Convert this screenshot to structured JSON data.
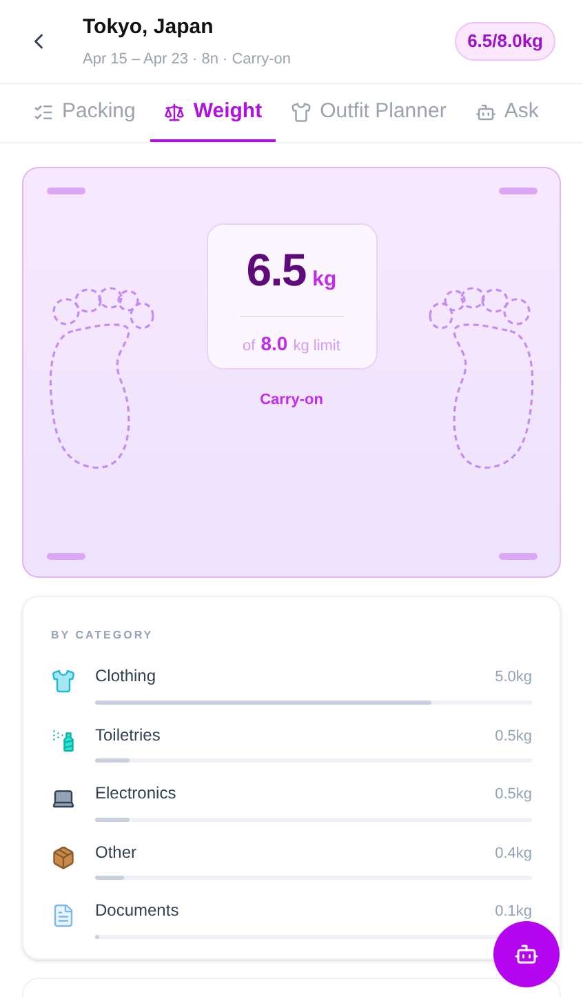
{
  "header": {
    "title": "Tokyo, Japan",
    "subtitle": "Apr 15 – Apr 23 · 8n · Carry-on",
    "badge": "6.5/8.0kg"
  },
  "tabs": [
    {
      "label": "Packing",
      "selected": false
    },
    {
      "label": "Weight",
      "selected": true
    },
    {
      "label": "Outfit Planner",
      "selected": false
    },
    {
      "label": "Ask",
      "selected": false
    }
  ],
  "scale": {
    "value": "6.5",
    "unit": "kg",
    "of": "of",
    "limit": "8.0",
    "limit_unit": "kg limit",
    "mode": "Carry-on"
  },
  "categories": {
    "heading": "BY CATEGORY",
    "items": [
      {
        "name": "Clothing",
        "reading": "5.0kg",
        "level": 0.77
      },
      {
        "name": "Toiletries",
        "reading": "0.5kg",
        "level": 0.08
      },
      {
        "name": "Electronics",
        "reading": "0.5kg",
        "level": 0.08
      },
      {
        "name": "Other",
        "reading": "0.4kg",
        "level": 0.065
      },
      {
        "name": "Documents",
        "reading": "0.1kg",
        "level": 0.01
      }
    ]
  }
}
